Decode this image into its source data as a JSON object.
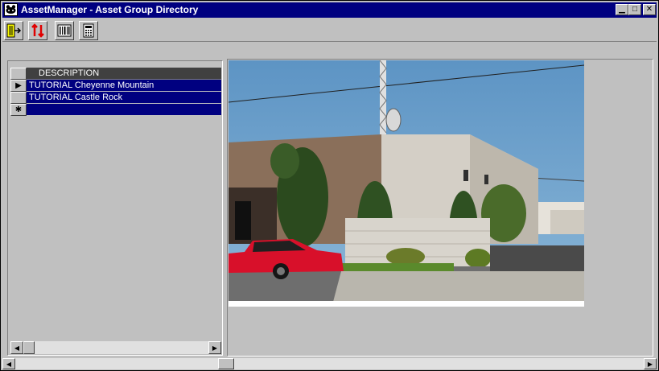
{
  "window": {
    "title": "AssetManager - Asset Group Directory"
  },
  "titlebar_buttons": {
    "minimize": "▁",
    "maximize": "□",
    "close": "✕"
  },
  "toolbar": {
    "icons": [
      "exit-door-icon",
      "sort-arrows-icon",
      "barcode-icon",
      "calculator-icon"
    ]
  },
  "grid": {
    "column_header": "DESCRIPTION",
    "rows": [
      {
        "indicator": "▶",
        "description": "TUTORIAL Cheyenne Mountain"
      },
      {
        "indicator": "",
        "description": "TUTORIAL Castle Rock"
      },
      {
        "indicator": "✱",
        "description": ""
      }
    ]
  },
  "scrollbar_glyphs": {
    "left": "◀",
    "right": "▶"
  },
  "colors": {
    "titlebar": "#000080",
    "selection": "#000080",
    "face": "#c0c0c0",
    "header": "#404040"
  }
}
